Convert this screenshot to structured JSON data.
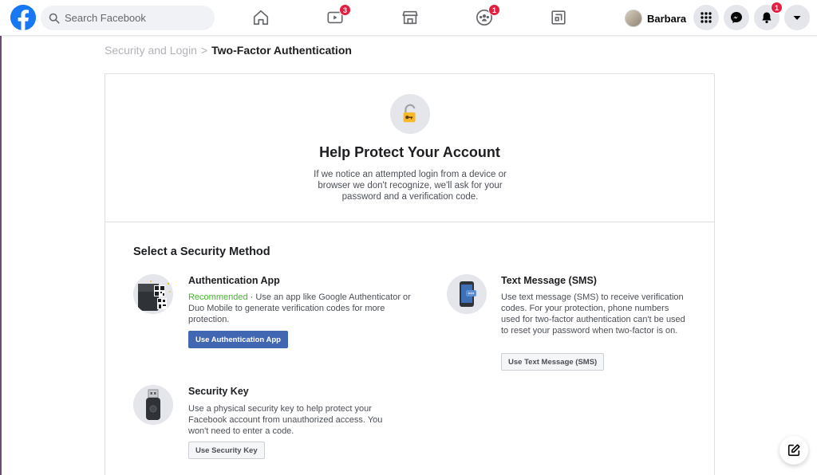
{
  "search": {
    "placeholder": "Search Facebook"
  },
  "nav": {
    "watch_badge": "3",
    "groups_badge": "1"
  },
  "profile": {
    "name": "Barbara"
  },
  "notifications_badge": "1",
  "breadcrumb": {
    "parent": "Security and Login",
    "separator": ">",
    "current": "Two-Factor Authentication"
  },
  "hero": {
    "title": "Help Protect Your Account",
    "description": "If we notice an attempted login from a device or browser we don't recognize, we'll ask for your password and a verification code."
  },
  "section_title": "Select a Security Method",
  "methods": {
    "auth_app": {
      "title": "Authentication App",
      "recommended": "Recommended",
      "description": " · Use an app like Google Authenticator or Duo Mobile to generate verification codes for more protection.",
      "button": "Use Authentication App"
    },
    "sms": {
      "title": "Text Message (SMS)",
      "description": "Use text message (SMS) to receive verification codes. For your protection, phone numbers used for two-factor authentication can't be used to reset your password when two-factor is on.",
      "button": "Use Text Message (SMS)"
    },
    "security_key": {
      "title": "Security Key",
      "description": "Use a physical security key to help protect your Facebook account from unauthorized access. You won't need to enter a code.",
      "button": "Use Security Key"
    }
  },
  "colors": {
    "brand": "#1877f2",
    "primary_button": "#4267b2",
    "recommended": "#42b72a",
    "badge": "#e41e3f"
  },
  "icons": [
    "facebook-logo-icon",
    "search-icon",
    "home-icon",
    "watch-icon",
    "marketplace-icon",
    "groups-icon",
    "gaming-icon",
    "menu-grid-icon",
    "messenger-icon",
    "bell-icon",
    "caret-down-icon",
    "lock-icon",
    "qr-phone-icon",
    "phone-sms-icon",
    "usb-key-icon",
    "compose-icon"
  ]
}
